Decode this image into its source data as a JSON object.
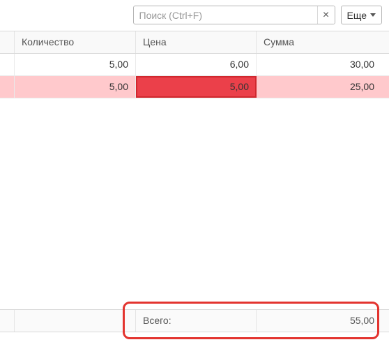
{
  "toolbar": {
    "search_placeholder": "Поиск (Ctrl+F)",
    "search_value": "",
    "clear_glyph": "×",
    "more_label": "Еще"
  },
  "grid": {
    "columns": {
      "qty": "Количество",
      "price": "Цена",
      "sum": "Сумма"
    },
    "rows": [
      {
        "qty": "5,00",
        "price": "6,00",
        "sum": "30,00",
        "highlight": false
      },
      {
        "qty": "5,00",
        "price": "5,00",
        "sum": "25,00",
        "highlight": true,
        "highlightCell": "price"
      }
    ],
    "footer": {
      "total_label": "Всего:",
      "total_value": "55,00"
    }
  }
}
